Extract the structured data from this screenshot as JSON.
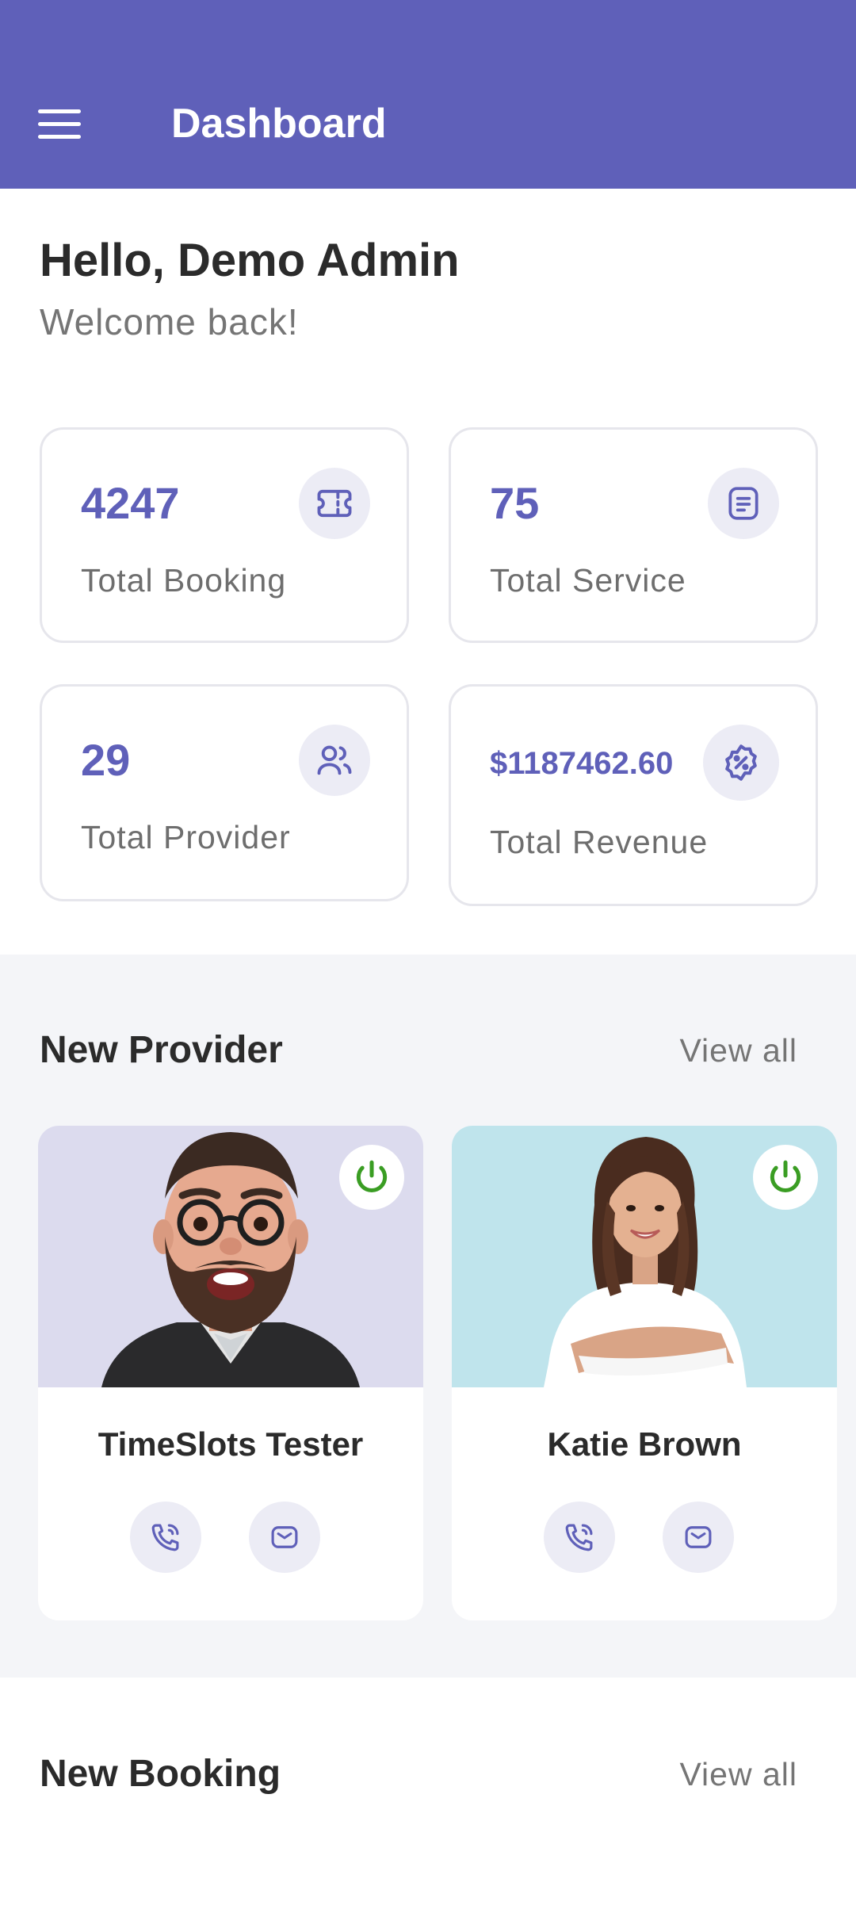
{
  "appbar": {
    "title": "Dashboard",
    "menu_icon": "menu-icon"
  },
  "greeting": {
    "title": "Hello, Demo Admin",
    "subtitle": "Welcome back!"
  },
  "stats": [
    {
      "value": "4247",
      "label": "Total Booking",
      "icon": "ticket-icon"
    },
    {
      "value": "75",
      "label": "Total Service",
      "icon": "document-icon"
    },
    {
      "value": "29",
      "label": "Total Provider",
      "icon": "users-icon"
    },
    {
      "value": "$1187462.60",
      "label": "Total Revenue",
      "icon": "discount-badge-icon"
    }
  ],
  "new_provider": {
    "title": "New Provider",
    "view_all": "View all",
    "items": [
      {
        "name": "TimeSlots Tester",
        "photo": "avatar-3d-bearded-man",
        "photo_bg": "#dcdbee",
        "status_icon": "power-icon",
        "status_color": "#3a9d23"
      },
      {
        "name": "Katie Brown",
        "photo": "photo-smiling-woman",
        "photo_bg": "#bfe4ec",
        "status_icon": "power-icon",
        "status_color": "#3a9d23"
      }
    ]
  },
  "new_booking": {
    "title": "New Booking",
    "view_all": "View all"
  },
  "colors": {
    "primary": "#5f60b9",
    "icon_bg": "#ececf5",
    "section_bg": "#f4f5f8",
    "online": "#3a9d23"
  }
}
